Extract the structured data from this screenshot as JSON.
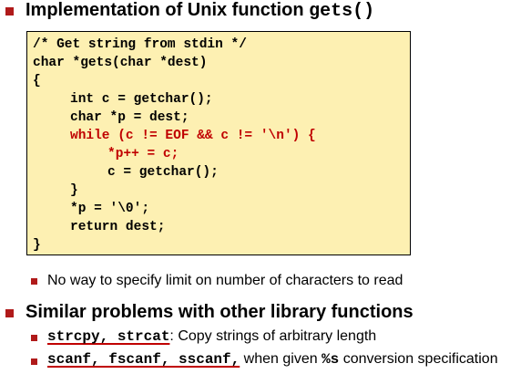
{
  "heading1": {
    "text": "Implementation of Unix function ",
    "code": "gets()"
  },
  "code": {
    "lines": [
      "/* Get string from stdin */",
      "char *gets(char *dest)",
      "{",
      "int c = getchar();",
      "char *p = dest;",
      "while (c != EOF && c != '\\n') {",
      "*p++ = c;",
      "c = getchar();",
      "}",
      "*p = '\\0';",
      "return dest;",
      "}"
    ],
    "highlight_color": "#c00000",
    "background_color": "#fdf0b2"
  },
  "sub1": {
    "text": "No way to specify limit on number of characters to read"
  },
  "heading2": {
    "text": "Similar problems with other library functions"
  },
  "sub2": {
    "code": "strcpy, strcat",
    "text": ": Copy strings of arbitrary length"
  },
  "sub3": {
    "code": "scanf, fscanf, sscanf,",
    "text_before": " when given ",
    "code2": "%s",
    "text_after": " conversion specification"
  },
  "colors": {
    "bullet": "#b01a1a",
    "accent": "#c00000"
  }
}
